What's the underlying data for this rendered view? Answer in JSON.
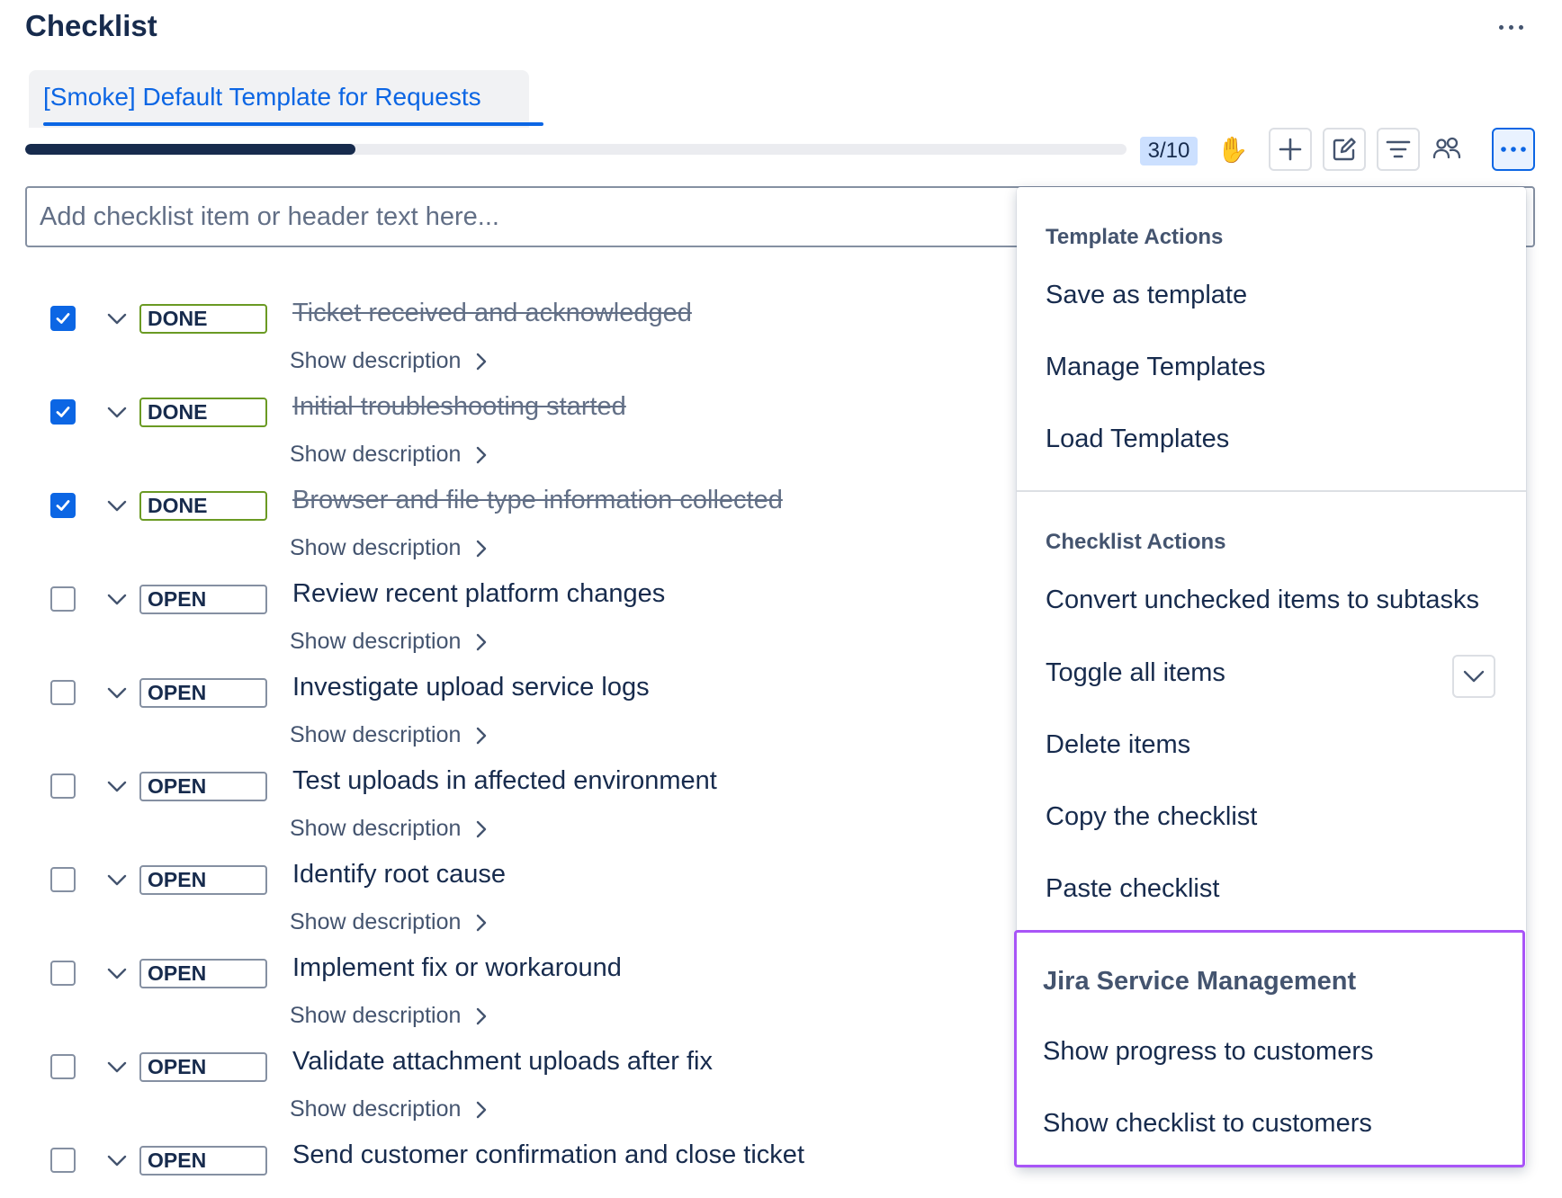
{
  "header": {
    "title": "Checklist"
  },
  "tabs": [
    {
      "label": "[Smoke] Default Template for Requests",
      "active": true
    }
  ],
  "progress": {
    "done": 3,
    "total": 10,
    "fraction": 0.3,
    "label": "3/10"
  },
  "toolbar": {
    "buttons": [
      {
        "name": "raise-hand",
        "icon": "raised-hand-emoji",
        "glyph": "✋"
      },
      {
        "name": "add",
        "icon": "plus-icon"
      },
      {
        "name": "edit",
        "icon": "edit-icon"
      },
      {
        "name": "filter",
        "icon": "filter-icon"
      },
      {
        "name": "assignees",
        "icon": "people-icon"
      },
      {
        "name": "more",
        "icon": "more-icon",
        "active": true
      }
    ]
  },
  "add_input": {
    "placeholder": "Add checklist item or header text here..."
  },
  "items": [
    {
      "checked": true,
      "status": "DONE",
      "text": "Ticket received and acknowledged",
      "desc_label": "Show description"
    },
    {
      "checked": true,
      "status": "DONE",
      "text": "Initial troubleshooting started",
      "desc_label": "Show description"
    },
    {
      "checked": true,
      "status": "DONE",
      "text": "Browser and file type information collected",
      "desc_label": "Show description"
    },
    {
      "checked": false,
      "status": "OPEN",
      "text": "Review recent platform changes",
      "desc_label": "Show description"
    },
    {
      "checked": false,
      "status": "OPEN",
      "text": "Investigate upload service logs",
      "desc_label": "Show description"
    },
    {
      "checked": false,
      "status": "OPEN",
      "text": "Test uploads in affected environment",
      "desc_label": "Show description"
    },
    {
      "checked": false,
      "status": "OPEN",
      "text": "Identify root cause",
      "desc_label": "Show description"
    },
    {
      "checked": false,
      "status": "OPEN",
      "text": "Implement fix or workaround",
      "desc_label": "Show description"
    },
    {
      "checked": false,
      "status": "OPEN",
      "text": "Validate attachment uploads after fix",
      "desc_label": "Show description"
    },
    {
      "checked": false,
      "status": "OPEN",
      "text": "Send customer confirmation and close ticket"
    }
  ],
  "menu": {
    "template_actions": {
      "heading": "Template Actions",
      "items": [
        "Save as template",
        "Manage Templates",
        "Load Templates"
      ]
    },
    "checklist_actions": {
      "heading": "Checklist Actions",
      "items": [
        "Convert unchecked items to subtasks",
        "Toggle all items",
        "Delete items",
        "Copy the checklist",
        "Paste checklist"
      ]
    },
    "jsm": {
      "heading": "Jira Service Management",
      "items": [
        "Show progress to customers",
        "Show checklist to customers"
      ]
    }
  },
  "colors": {
    "accent": "#0c66e4",
    "done_border": "#6a9a23",
    "highlight_border": "#a855f7",
    "progress_fill": "#172b4d",
    "progress_badge": "#cce0ff"
  }
}
